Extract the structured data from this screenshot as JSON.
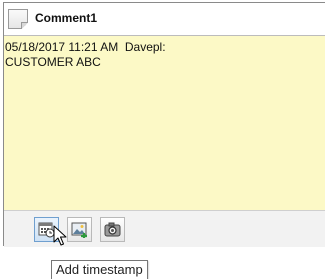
{
  "comment_window": {
    "title": "Comment1",
    "lines": [
      "05/18/2017 11:21 AM  Davepl:",
      "CUSTOMER ABC"
    ],
    "body_color": "#fcf9c6"
  },
  "toolbar": {
    "buttons": [
      {
        "icon": "calendar-clock-icon",
        "tooltip": "Add timestamp"
      },
      {
        "icon": "insert-image-icon"
      },
      {
        "icon": "camera-icon"
      }
    ]
  },
  "tooltip": {
    "text": "Add timestamp"
  },
  "colors": {
    "accent": "#6f9fcf",
    "note_yellow": "#fcf9c6"
  }
}
